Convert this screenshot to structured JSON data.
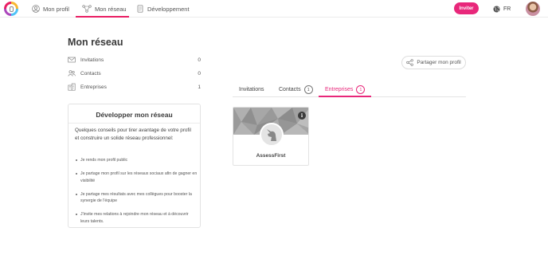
{
  "nav": {
    "items": [
      {
        "label": "Mon profil",
        "icon": "user-circle-icon"
      },
      {
        "label": "Mon réseau",
        "icon": "network-icon"
      },
      {
        "label": "Développement",
        "icon": "document-icon"
      }
    ],
    "invite_label": "Inviter",
    "language": "FR",
    "accent_color": "#e8277a"
  },
  "page": {
    "title": "Mon réseau"
  },
  "stats": [
    {
      "label": "Invitations",
      "count": "0",
      "icon": "envelope-icon"
    },
    {
      "label": "Contacts",
      "count": "0",
      "icon": "people-icon"
    },
    {
      "label": "Entreprises",
      "count": "1",
      "icon": "building-icon"
    }
  ],
  "tips": {
    "title": "Développer mon réseau",
    "intro": "Quelques conseils pour tirer avantage de votre profil et construire un solide réseau professionnel:",
    "items": [
      "Je rends mon profil public",
      "Je partage mon profil sur les réseaux sociaux afin de gagner en visibilité",
      "Je partage mes résultats avec mes collègues pour booster la synergie de l'équipe",
      "J'invite mes relations à rejoindre mon réseau et à découvrir leurs talents."
    ]
  },
  "share": {
    "label": "Partager mon profil",
    "icon": "share-icon"
  },
  "tabs": [
    {
      "label": "Invitations",
      "badge": ""
    },
    {
      "label": "Contacts",
      "badge": "1"
    },
    {
      "label": "Entreprises",
      "badge": "1",
      "active": true
    }
  ],
  "companies": [
    {
      "name": "AssessFirst",
      "info_icon": "i"
    }
  ]
}
